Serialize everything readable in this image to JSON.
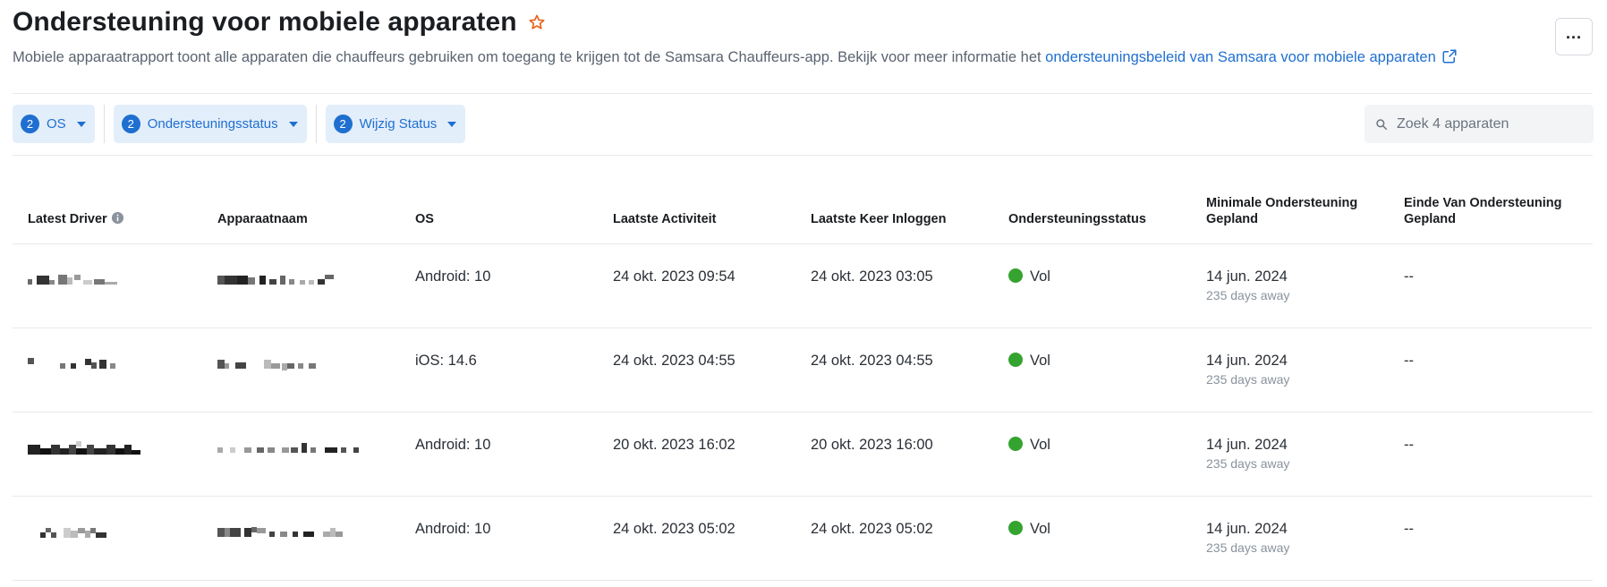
{
  "header": {
    "title": "Ondersteuning voor mobiele apparaten",
    "subtitle_text": "Mobiele apparaatrapport toont alle apparaten die chauffeurs gebruiken om toegang te krijgen tot de Samsara Chauffeurs-app. Bekijk voor meer informatie het ",
    "subtitle_link": "ondersteuningsbeleid van Samsara voor mobiele apparaten",
    "more_label": "...",
    "star_color": "#e8631c"
  },
  "filters": [
    {
      "count": "2",
      "label": "OS"
    },
    {
      "count": "2",
      "label": "Ondersteuningsstatus"
    },
    {
      "count": "2",
      "label": "Wijzig Status"
    }
  ],
  "search": {
    "placeholder": "Zoek 4 apparaten"
  },
  "table": {
    "columns": {
      "latest_driver": "Latest Driver",
      "device_name": "Apparaatnaam",
      "os": "OS",
      "last_activity": "Laatste Activiteit",
      "last_login": "Laatste Keer Inloggen",
      "support_status": "Ondersteuningsstatus",
      "min_support": "Minimale Ondersteuning Gepland",
      "end_support": "Einde Van Ondersteuning Gepland"
    },
    "rows": [
      {
        "os": "Android: 10",
        "last_activity": "24 okt. 2023 09:54",
        "last_login": "24 okt. 2023 03:05",
        "status": "Vol",
        "min_support": "14 jun. 2024",
        "min_support_sub": "235 days away",
        "end_support": "--"
      },
      {
        "os": "iOS: 14.6",
        "last_activity": "24 okt. 2023 04:55",
        "last_login": "24 okt. 2023 04:55",
        "status": "Vol",
        "min_support": "14 jun. 2024",
        "min_support_sub": "235 days away",
        "end_support": "--"
      },
      {
        "os": "Android: 10",
        "last_activity": "20 okt. 2023 16:02",
        "last_login": "20 okt. 2023 16:00",
        "status": "Vol",
        "min_support": "14 jun. 2024",
        "min_support_sub": "235 days away",
        "end_support": "--"
      },
      {
        "os": "Android: 10",
        "last_activity": "24 okt. 2023 05:02",
        "last_login": "24 okt. 2023 05:02",
        "status": "Vol",
        "min_support": "14 jun. 2024",
        "min_support_sub": "235 days away",
        "end_support": "--"
      }
    ]
  },
  "colors": {
    "accent": "#1f6fd0",
    "status_ok": "#35a32f",
    "chip_bg": "#e3eefb"
  }
}
